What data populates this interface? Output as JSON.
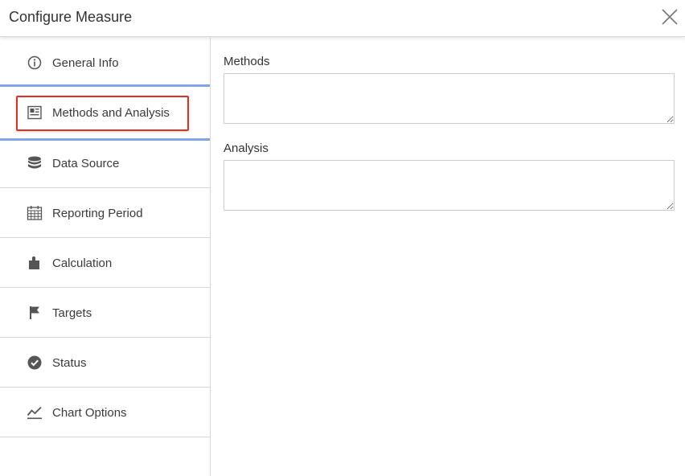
{
  "dialog": {
    "title": "Configure Measure",
    "close_icon": "close-icon"
  },
  "sidebar": {
    "items": [
      {
        "label": "General Info",
        "icon": "info-circle-icon"
      },
      {
        "label": "Methods and Analysis",
        "icon": "document-list-icon",
        "active": true
      },
      {
        "label": "Data Source",
        "icon": "database-icon"
      },
      {
        "label": "Reporting Period",
        "icon": "calendar-icon"
      },
      {
        "label": "Calculation",
        "icon": "puzzle-icon"
      },
      {
        "label": "Targets",
        "icon": "flag-icon"
      },
      {
        "label": "Status",
        "icon": "check-circle-icon"
      },
      {
        "label": "Chart Options",
        "icon": "line-chart-icon"
      }
    ]
  },
  "main": {
    "methods": {
      "label": "Methods",
      "value": ""
    },
    "analysis": {
      "label": "Analysis",
      "value": ""
    }
  },
  "colors": {
    "active_border": "#7ea6e6",
    "highlight": "#e0301e",
    "icon": "#555555"
  }
}
